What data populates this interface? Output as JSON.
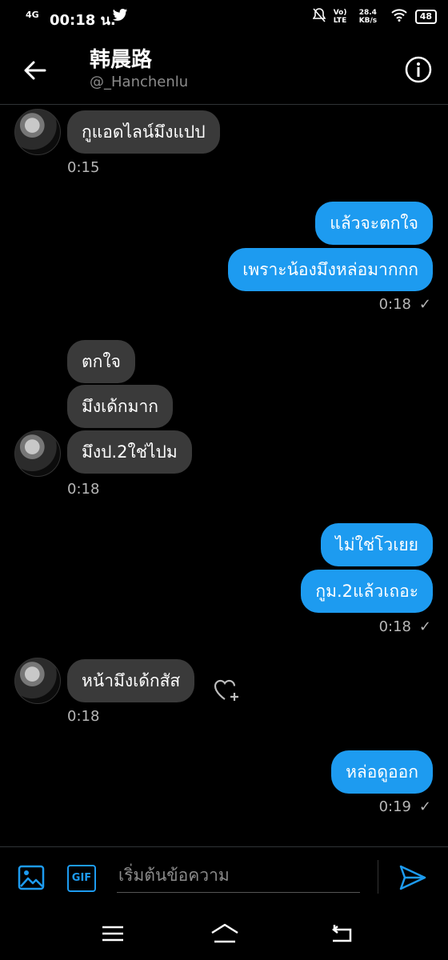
{
  "status_bar": {
    "network": "4G",
    "time": "00:18 น.",
    "volte": "Vo) LTE",
    "speed": "28.4 KB/s",
    "battery": "48"
  },
  "header": {
    "name": "韩晨路",
    "handle": "@_Hanchenlu"
  },
  "messages": {
    "m1": "กูแอดไลน์มึงแปป",
    "t1": "0:15",
    "m2": "แล้วจะตกใจ",
    "m3": "เพราะน้องมึงหล่อมากกก",
    "t2": "0:18",
    "m4": "ตกใจ",
    "m5": "มึงเด้กมาก",
    "m6": "มึงป.2ใช่ไปม",
    "t3": "0:18",
    "m7": "ไม่ใช่โวเยย",
    "m8": "กูม.2แล้วเถอะ",
    "t4": "0:18",
    "m9": "หน้ามึงเด้กสัส",
    "t5": "0:18",
    "m10": "หล่อดูออก",
    "t6": "0:19"
  },
  "composer": {
    "gif_label": "GIF",
    "placeholder": "เริ่มต้นข้อความ"
  },
  "colors": {
    "accent": "#1d9bf0",
    "incoming_bubble": "#3a3a3a",
    "background": "#000000"
  }
}
